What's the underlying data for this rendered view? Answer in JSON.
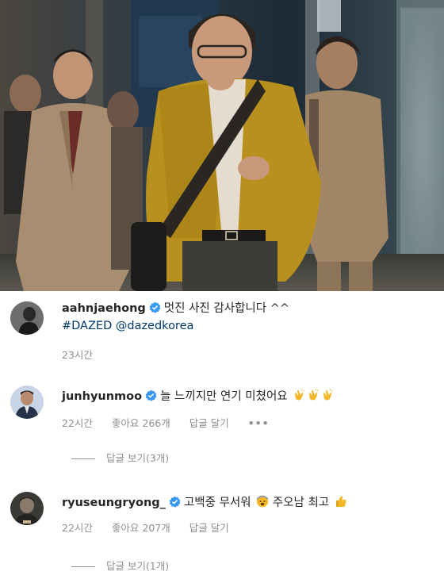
{
  "comments": [
    {
      "username": "aahnjaehong",
      "text": "멋진 사진 감사합니다 ^^",
      "hashtag": "#DAZED",
      "mention": "@dazedkorea",
      "time": "23시간"
    },
    {
      "username": "junhyunmoo",
      "text": "늘 느끼지만 연기 미쳤어요",
      "emoji": "clapping-hands",
      "time": "22시간",
      "likes": "좋아요 266개",
      "reply": "답글 달기",
      "more": "•••",
      "view_replies": "답글 보기(3개)"
    },
    {
      "username": "ryuseungryong_",
      "text_a": "고백중 무서워",
      "text_b": "주오남 최고",
      "emoji_a": "fearful-face",
      "emoji_b": "thumbs-up",
      "time": "22시간",
      "likes": "좋아요 207개",
      "reply": "답글 달기",
      "view_replies": "답글 보기(1개)"
    }
  ],
  "colors": {
    "verified": "#3897f0",
    "link": "#00376b",
    "muted": "#8e8e8e",
    "jacket": "#b8901e"
  }
}
